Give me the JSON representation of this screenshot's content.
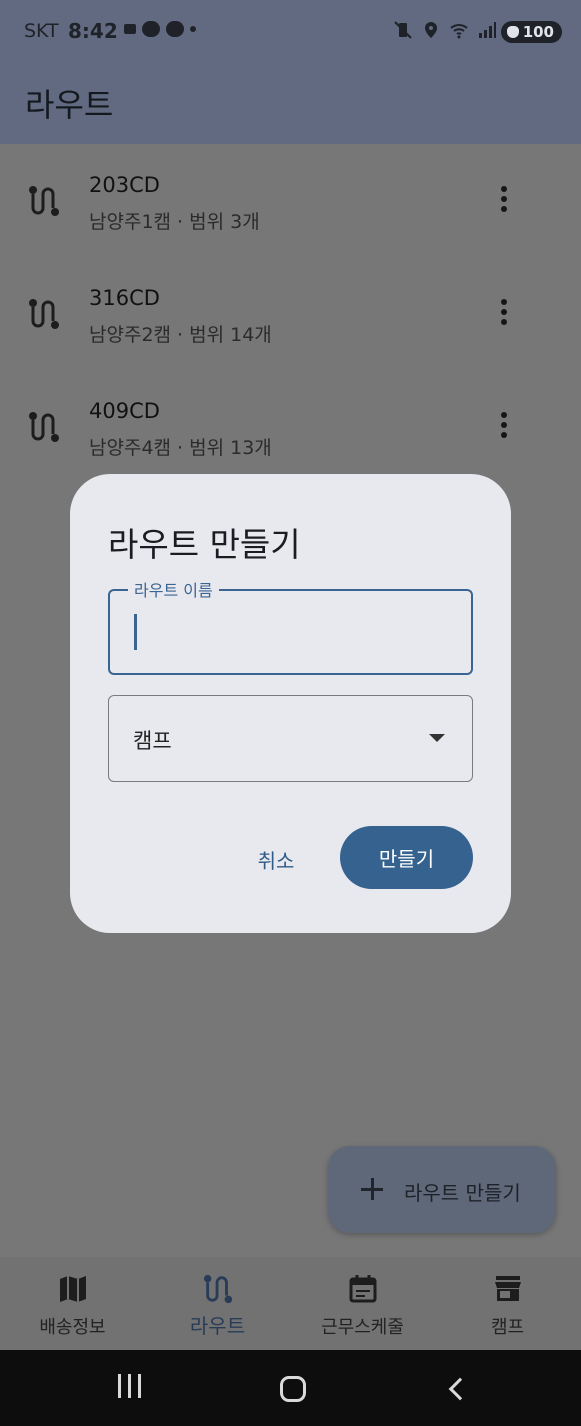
{
  "status_bar": {
    "carrier": "SKT",
    "time": "8:42",
    "battery": "100"
  },
  "app_bar": {
    "title": "라우트"
  },
  "routes": [
    {
      "name": "203CD",
      "subtitle": "남양주1캠 · 범위 3개"
    },
    {
      "name": "316CD",
      "subtitle": "남양주2캠 · 범위 14개"
    },
    {
      "name": "409CD",
      "subtitle": "남양주4캠 · 범위 13개"
    }
  ],
  "dialog": {
    "title": "라우트 만들기",
    "name_field": {
      "label": "라우트 이름",
      "value": ""
    },
    "camp_select": {
      "label": "캠프"
    },
    "cancel_label": "취소",
    "create_label": "만들기"
  },
  "fab": {
    "label": "라우트 만들기"
  },
  "bottom_nav": [
    {
      "label": "배송정보",
      "icon": "map-icon"
    },
    {
      "label": "라우트",
      "icon": "route-icon",
      "active": true
    },
    {
      "label": "근무스케줄",
      "icon": "calendar-icon"
    },
    {
      "label": "캠프",
      "icon": "store-icon"
    }
  ]
}
